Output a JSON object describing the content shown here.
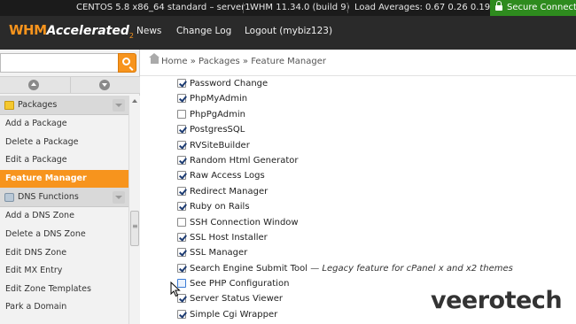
{
  "status_bar": {
    "os": "CENTOS 5.8 x86_64 standard – server1",
    "whm_version": "WHM 11.34.0 (build 9)",
    "load": "Load Averages: 0.67 0.26 0.19",
    "secure": "Secure Connection"
  },
  "header": {
    "logo_whm": "WHM",
    "logo_accelerated": "Accelerated",
    "logo_sup": "2",
    "nav": [
      "News",
      "Change Log",
      "Logout (mybiz123)"
    ]
  },
  "search": {
    "value": "",
    "placeholder": ""
  },
  "sidebar": {
    "sections": [
      {
        "title": "Packages",
        "icon": "package-icon",
        "items": [
          "Add a Package",
          "Delete a Package",
          "Edit a Package",
          "Feature Manager"
        ],
        "active": "Feature Manager"
      },
      {
        "title": "DNS Functions",
        "icon": "dns-icon",
        "items": [
          "Add a DNS Zone",
          "Delete a DNS Zone",
          "Edit DNS Zone",
          "Edit MX Entry",
          "Edit Zone Templates",
          "Park a Domain"
        ]
      }
    ]
  },
  "breadcrumb": {
    "home": "Home",
    "sep": "»",
    "packages": "Packages",
    "current": "Feature Manager"
  },
  "features": [
    {
      "label": "Password Change",
      "checked": true
    },
    {
      "label": "PhpMyAdmin",
      "checked": true
    },
    {
      "label": "PhpPgAdmin",
      "checked": false
    },
    {
      "label": "PostgresSQL",
      "checked": true
    },
    {
      "label": "RVSiteBuilder",
      "checked": true
    },
    {
      "label": "Random Html Generator",
      "checked": true
    },
    {
      "label": "Raw Access Logs",
      "checked": true
    },
    {
      "label": "Redirect Manager",
      "checked": true
    },
    {
      "label": "Ruby on Rails",
      "checked": true
    },
    {
      "label": "SSH Connection Window",
      "checked": false
    },
    {
      "label": "SSL Host Installer",
      "checked": true
    },
    {
      "label": "SSL Manager",
      "checked": true
    },
    {
      "label": "Search Engine Submit Tool",
      "checked": true,
      "note": "— Legacy feature for cPanel x and x2 themes"
    },
    {
      "label": "See PHP Configuration",
      "checked": false,
      "hover": true
    },
    {
      "label": "Server Status Viewer",
      "checked": true
    },
    {
      "label": "Simple Cgi Wrapper",
      "checked": true
    }
  ],
  "watermark": "veerotech",
  "colors": {
    "accent": "#f7941d",
    "header_bg": "#2a2a2a",
    "statusbar_bg": "#1b1b1b",
    "secure_bg": "#2e8b1e"
  }
}
